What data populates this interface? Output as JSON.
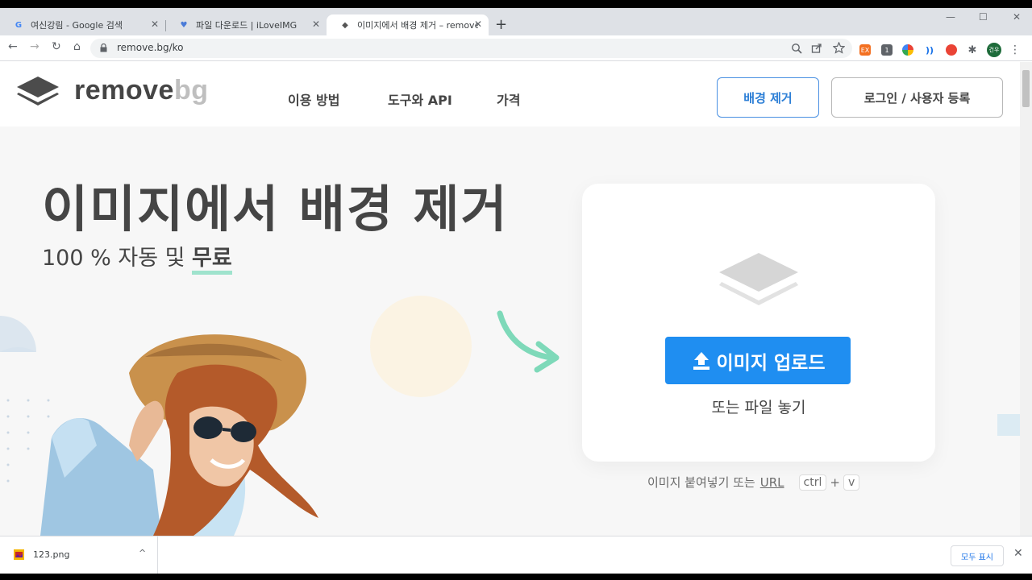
{
  "browser": {
    "tabs": [
      {
        "favicon": "G",
        "title": "여신강림 - Google 검색",
        "close": "✕"
      },
      {
        "favicon": "♥",
        "title": "파일 다운로드 | iLoveIMG",
        "close": "✕"
      },
      {
        "favicon": "◆",
        "title": "이미지에서 배경 제거 – remove",
        "close": "✕"
      }
    ],
    "new_tab": "+",
    "window_controls": {
      "minimize": "—",
      "maximize": "☐",
      "close": "✕"
    },
    "nav": {
      "back": "←",
      "forward": "→",
      "reload": "↻",
      "home": "⌂"
    },
    "url": "remove.bg/ko",
    "omnibox_icons": [
      "zoom-icon",
      "share-icon",
      "star-icon"
    ],
    "extensions": [
      {
        "label": "EX",
        "color": "#f37021"
      },
      {
        "label": "1",
        "color": "#5f6368"
      },
      {
        "label": "",
        "color": "#34a853"
      },
      {
        "label": "))",
        "color": "#1a73e8"
      },
      {
        "label": "",
        "color": "#ea4335"
      },
      {
        "label": "",
        "color": "#5f6368"
      }
    ],
    "profile": "건우",
    "menu": "⋮"
  },
  "site": {
    "logo": {
      "part1": "remove",
      "part2": "bg"
    },
    "nav": {
      "how": "이용 방법",
      "tools": "도구와 API",
      "pricing": "가격"
    },
    "btn_remove": "배경 제거",
    "btn_login": "로그인 / 사용자 등록",
    "hero": {
      "title": "이미지에서 배경 제거",
      "subtitle_pre": "100 % 자동 및 ",
      "subtitle_highlight": "무료"
    },
    "upload": {
      "button": "이미지 업로드",
      "drop_text": "또는 파일 놓기",
      "paste_pre": "이미지 붙여넣기 또는 ",
      "paste_url": "URL",
      "key_ctrl": "ctrl",
      "key_plus": "+",
      "key_v": "v"
    },
    "colors": {
      "accent": "#1f8ef1",
      "highlight": "#9fe3cd",
      "arrow": "#7ed9b9"
    }
  },
  "downloads": {
    "file": "123.png",
    "chevron": "^",
    "show_all": "모두 표시",
    "close": "✕"
  }
}
